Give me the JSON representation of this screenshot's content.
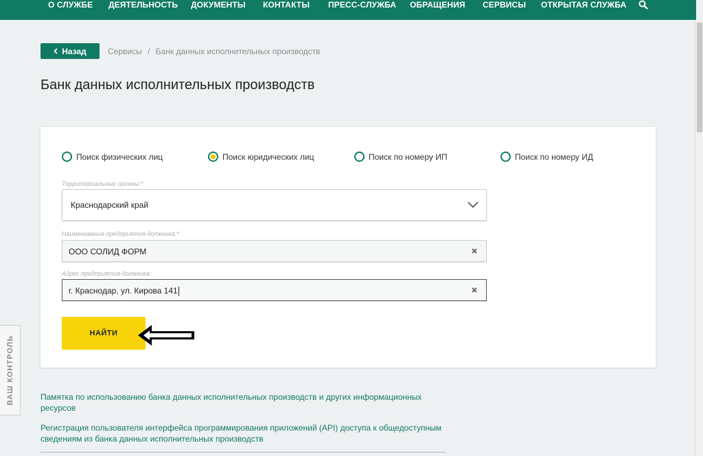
{
  "nav": {
    "items": [
      "О СЛУЖБЕ",
      "ДЕЯТЕЛЬНОСТЬ",
      "ДОКУМЕНТЫ",
      "КОНТАКТЫ",
      "ПРЕСС-СЛУЖБА",
      "ОБРАЩЕНИЯ",
      "СЕРВИСЫ",
      "ОТКРЫТАЯ СЛУЖБА"
    ],
    "search_icon": "search-icon",
    "color": "#117a62"
  },
  "breadcrumb": {
    "back_label": "Назад",
    "items": [
      "Сервисы",
      "Банк данных исполнительных производств"
    ],
    "separator": "/"
  },
  "page_title": "Банк данных исполнительных производств",
  "search_form": {
    "radios": [
      {
        "label": "Поиск физических лиц",
        "checked": false
      },
      {
        "label": "Поиск юридических лиц",
        "checked": true
      },
      {
        "label": "Поиск по номеру ИП",
        "checked": false
      },
      {
        "label": "Поиск по номеру ИД",
        "checked": false
      }
    ],
    "region": {
      "label": "Территориальные органы:*",
      "value": "Краснодарский край"
    },
    "company": {
      "label": "Наименование предприятия-должника:*",
      "value": "ООО СОЛИД ФОРМ"
    },
    "address": {
      "label": "Адрес предприятия-должника:",
      "value": "г. Краснодар, ул. Кирова 141"
    },
    "submit_label": "НАЙТИ",
    "submit_color": "#f7d40a"
  },
  "side_widget": {
    "label": "ВАШ КОНТРОЛЬ"
  },
  "links": [
    "Памятка по использованию банка данных исполнительных производств и других информационных ресурсов",
    "Регистрация пользователя интерфейса программирования приложений (API) доступа к общедоступным сведениям из банка данных исполнительных производств"
  ]
}
